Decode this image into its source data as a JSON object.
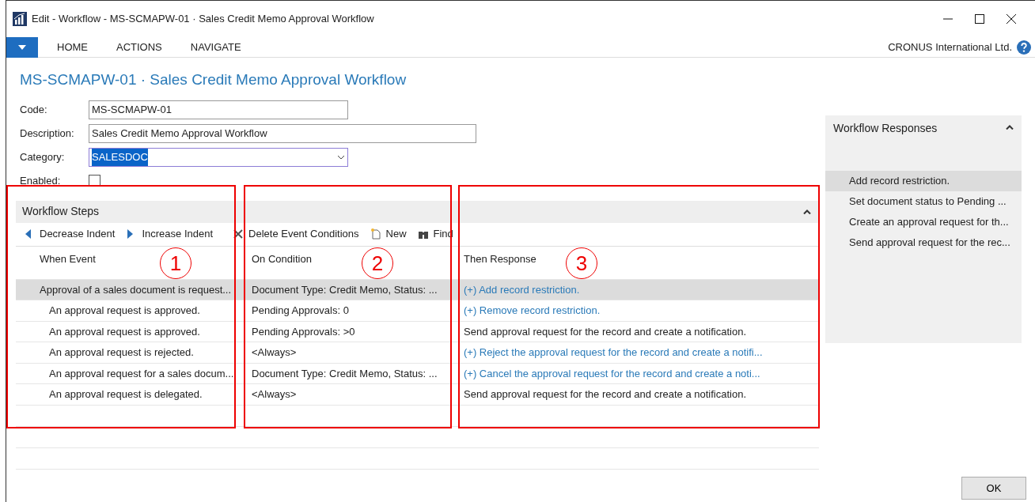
{
  "window": {
    "title": "Edit - Workflow - MS-SCMAPW-01 · Sales Credit Memo Approval Workflow"
  },
  "ribbon": {
    "tabs": [
      {
        "label": "HOME",
        "selected": false
      },
      {
        "label": "ACTIONS",
        "selected": false
      },
      {
        "label": "NAVIGATE",
        "selected": false
      }
    ],
    "company": "CRONUS International Ltd."
  },
  "page_title": "MS-SCMAPW-01 · Sales Credit Memo Approval Workflow",
  "fields": [
    {
      "label": "Code:",
      "kind": "text",
      "value": "MS-SCMAPW-01"
    },
    {
      "label": "Description:",
      "kind": "text",
      "value": "Sales Credit Memo Approval Workflow"
    },
    {
      "label": "Category:",
      "kind": "select",
      "value": "SALESDOC"
    },
    {
      "label": "Enabled:",
      "kind": "checkbox",
      "checked": false
    }
  ],
  "steps": {
    "title": "Workflow Steps",
    "expanded": true,
    "actions": [
      {
        "label": "Decrease Indent",
        "kind": "left"
      },
      {
        "label": "Increase Indent",
        "kind": "right"
      },
      {
        "label": "Delete Event Conditions",
        "kind": "delete"
      },
      {
        "label": "New",
        "kind": "new"
      },
      {
        "label": "Find",
        "kind": "find"
      }
    ],
    "columns": [
      "When Event",
      "On Condition",
      "Then Response"
    ],
    "rows": [
      {
        "event": "Approval of a sales document is request...",
        "condition": "Document Type: Credit Memo, Status: ...",
        "response": "(+) Add record restriction.",
        "linked": true,
        "selected": true,
        "children": [
          {
            "event": "An approval request is approved.",
            "condition": "Pending Approvals: 0",
            "response": "(+) Remove record restriction.",
            "linked": true,
            "selected": false
          },
          {
            "event": "An approval request is approved.",
            "condition": "Pending Approvals: >0",
            "response": "Send approval request for the record and create a notification.",
            "linked": false,
            "selected": false
          },
          {
            "event": "An approval request is rejected.",
            "condition": "<Always>",
            "response": "(+) Reject the approval request for the record and create a notifi...",
            "linked": true,
            "selected": false
          },
          {
            "event": "An approval request for a sales docum...",
            "condition": "Document Type: Credit Memo, Status: ...",
            "response": "(+) Cancel the approval request for the record and create a noti...",
            "linked": true,
            "selected": false
          },
          {
            "event": "An approval request is delegated.",
            "condition": "<Always>",
            "response": "Send approval request for the record and create a notification.",
            "linked": false,
            "selected": false
          }
        ]
      }
    ]
  },
  "responses_panel": {
    "title": "Workflow Responses",
    "expanded": true,
    "items": [
      {
        "label": "Add record restriction.",
        "selected": true
      },
      {
        "label": "Set document status to Pending ...",
        "selected": false
      },
      {
        "label": "Create an approval request for th...",
        "selected": false
      },
      {
        "label": "Send approval request for the rec...",
        "selected": false
      }
    ]
  },
  "annotations": [
    "1",
    "2",
    "3"
  ],
  "ok_button": "OK"
}
